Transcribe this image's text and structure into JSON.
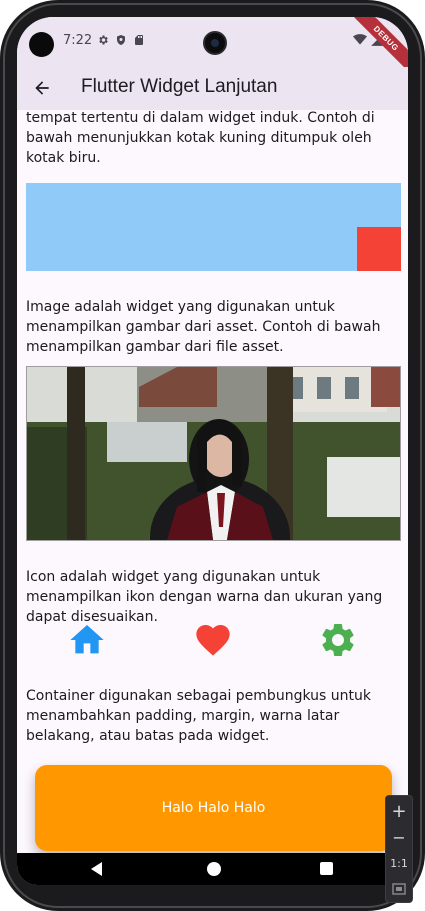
{
  "status_bar": {
    "time": "7:22",
    "left_icons": [
      "settings-icon",
      "shield-icon",
      "sd-card-icon"
    ],
    "right_icons": [
      "wifi-icon",
      "signal-icon",
      "battery-icon"
    ]
  },
  "debug_banner": {
    "label": "DEBUG",
    "color": "#b5303a"
  },
  "app_bar": {
    "title": "Flutter Widget Lanjutan",
    "back_icon": "arrow-back-icon"
  },
  "sections": {
    "align_text": "tempat tertentu di dalam widget induk. Contoh di bawah menunjukkan kotak kuning ditumpuk oleh kotak biru.",
    "image_text": "Image adalah widget yang digunakan untuk menampilkan gambar dari asset. Contoh di bawah menampilkan gambar dari file asset.",
    "icon_text": "Icon adalah widget yang digunakan untuk menampilkan ikon dengan warna dan ukuran yang dapat disesuaikan.",
    "container_text": "Container digunakan sebagai pembungkus untuk menambahkan padding, margin, warna latar belakang, atau batas pada widget."
  },
  "icons_row": [
    {
      "name": "home-icon",
      "color": "#2196f3"
    },
    {
      "name": "favorite-icon",
      "color": "#f44336"
    },
    {
      "name": "settings-icon",
      "color": "#4caf50"
    }
  ],
  "container_demo": {
    "label": "Halo Halo Halo",
    "color": "#ff9800"
  },
  "colors": {
    "app_bar_bg": "#ece4f1",
    "page_bg": "#fdf7fe",
    "align_outer_box": "#90caf9",
    "align_inner_box": "#f44336"
  },
  "zoom_controls": {
    "plus": "+",
    "minus": "−",
    "reset": "1:1"
  }
}
